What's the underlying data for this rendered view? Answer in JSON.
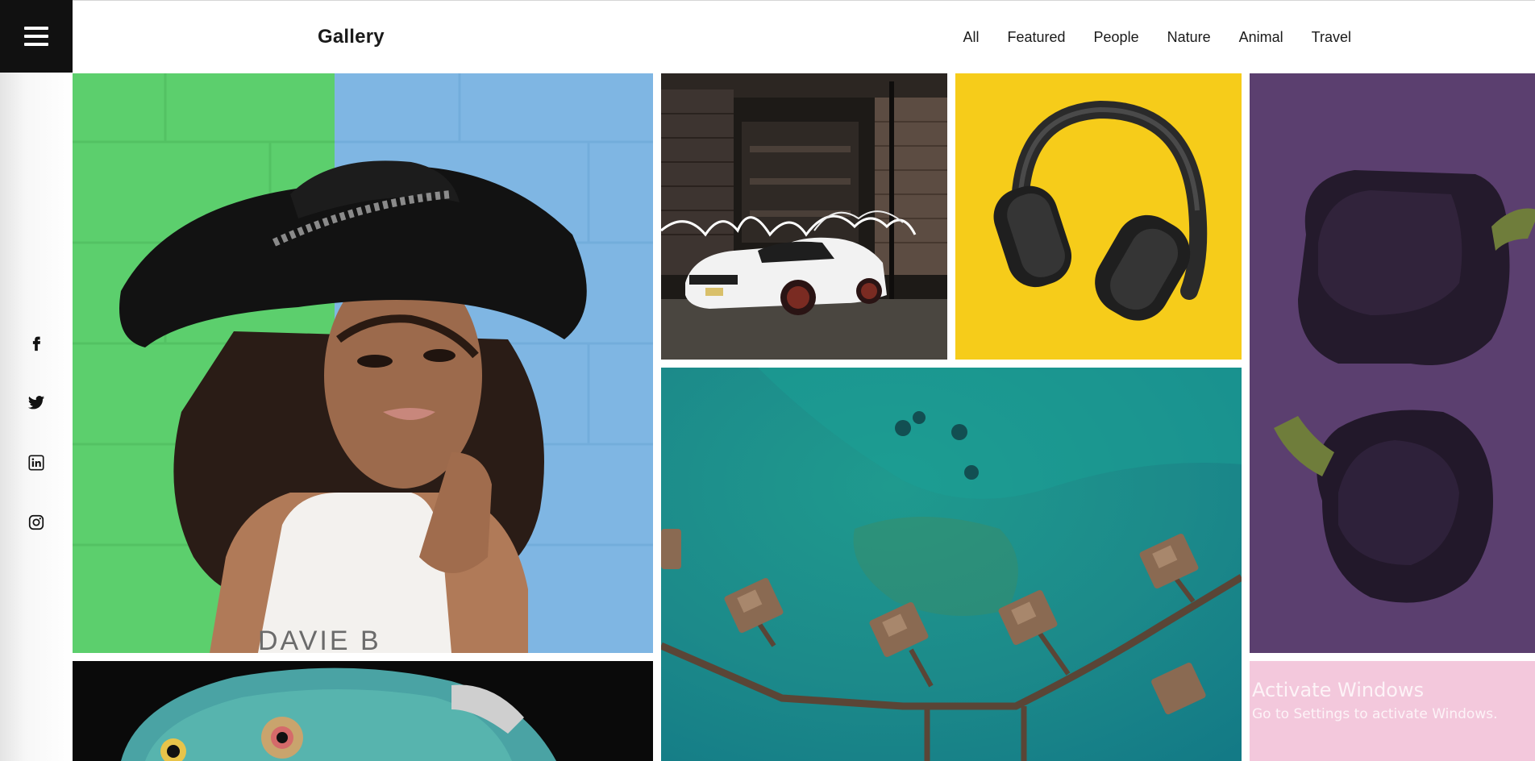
{
  "header": {
    "brand": "Gallery",
    "nav": [
      "All",
      "Featured",
      "People",
      "Nature",
      "Animal",
      "Travel"
    ]
  },
  "sidebar": {
    "menu_icon": "hamburger-icon",
    "social": [
      "facebook-icon",
      "twitter-icon",
      "linkedin-icon",
      "instagram-icon"
    ]
  },
  "gallery": {
    "tiles": [
      "woman-in-hat",
      "white-car-light-painting",
      "headphones-on-yellow",
      "purple-peppers",
      "overwater-bungalows",
      "chameleon",
      "pink-tile"
    ]
  },
  "watermark": {
    "title": "Activate Windows",
    "subtitle": "Go to Settings to activate Windows."
  },
  "colors": {
    "header_bg": "#ffffff",
    "menu_box": "#111111",
    "text": "#1a1a1a",
    "yellow": "#f6cc1a",
    "purple": "#5b3f6f",
    "teal": "#1f8a8a",
    "pink": "#f3c8dc"
  }
}
